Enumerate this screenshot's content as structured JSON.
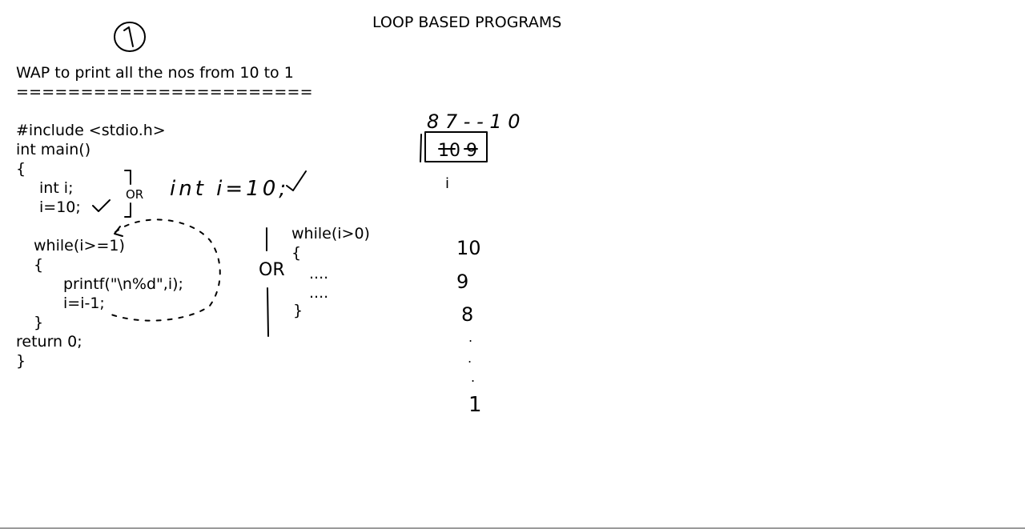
{
  "page": {
    "title": "LOOP BASED PROGRAMS",
    "background": "#ffffff",
    "ink": "#000000"
  },
  "problem": {
    "number": "1",
    "statement": "WAP to print all the nos from 10 to 1",
    "underline": "======================="
  },
  "code": {
    "lines": [
      "#include <stdio.h>",
      "int main()",
      "{",
      "int i;",
      "i=10;",
      "while(i>=1)",
      "{",
      "printf(\"\\n%d\",i);",
      "i=i-1;",
      "}",
      "return 0;",
      "}"
    ]
  },
  "annotations": {
    "or_1": "OR",
    "alt_decl": "int i=10;",
    "or_2": "OR",
    "alt_loop": {
      "header": "while(i>0)",
      "open": "{",
      "body_1": "....",
      "body_2": "....",
      "close": "}"
    },
    "memory": {
      "previous_values": "8 7 - - 1 0",
      "box_value": "10 9",
      "var_label": "i"
    },
    "output": [
      "10",
      "9",
      "8",
      ".",
      ".",
      ".",
      "1"
    ]
  }
}
